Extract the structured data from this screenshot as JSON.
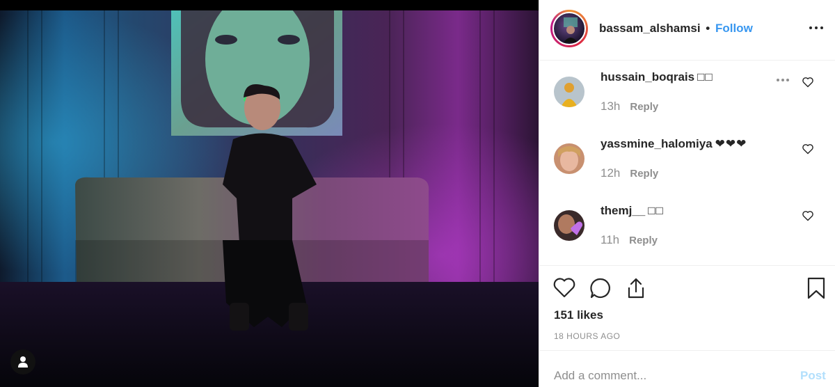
{
  "header": {
    "username": "bassam_alshamsi",
    "separator": "•",
    "follow_label": "Follow"
  },
  "comments": [
    {
      "username": "hussain_boqrais",
      "text": "□□",
      "time": "13h",
      "reply_label": "Reply"
    },
    {
      "username": "yassmine_halomiya",
      "text": "❤❤❤",
      "time": "12h",
      "reply_label": "Reply"
    },
    {
      "username": "themj__",
      "text": "□□",
      "time": "11h",
      "reply_label": "Reply"
    }
  ],
  "stats": {
    "likes": "151 likes",
    "time_ago": "18 HOURS AGO"
  },
  "composer": {
    "placeholder": "Add a comment...",
    "post_label": "Post"
  },
  "icons": [
    "more-options-icon",
    "heart-icon",
    "comment-icon",
    "share-icon",
    "bookmark-icon",
    "user-tag-icon"
  ],
  "colors": {
    "link_blue": "#3897f0",
    "post_disabled": "#b2dffc",
    "muted_text": "#8e8e8e",
    "border": "#efefef"
  }
}
